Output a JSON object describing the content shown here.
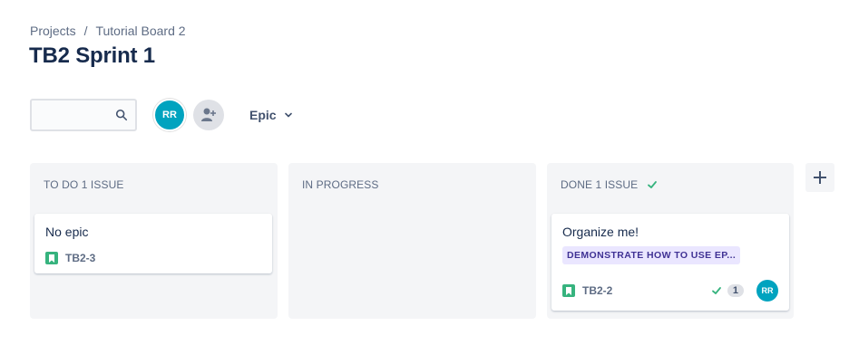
{
  "breadcrumb": {
    "project": "Projects",
    "separator": "/",
    "board": "Tutorial Board 2"
  },
  "title": "TB2 Sprint 1",
  "toolbar": {
    "search_value": "",
    "search_placeholder": "",
    "search_icon": "search-icon",
    "avatar_initials": "RR",
    "add_person_icon": "add-person-icon",
    "epic_filter_label": "Epic",
    "accent_color": "#00a3bf"
  },
  "columns": [
    {
      "header": "TO DO 1 ISSUE",
      "cards": [
        {
          "summary": "No epic",
          "key": "TB2-3"
        }
      ]
    },
    {
      "header": "IN PROGRESS",
      "cards": []
    },
    {
      "header": "DONE 1 ISSUE",
      "header_icon": "check-icon",
      "cards": [
        {
          "summary": "Organize me!",
          "epic": "DEMONSTRATE HOW TO USE EP...",
          "key": "TB2-2",
          "count": "1",
          "assignee": "RR"
        }
      ]
    }
  ],
  "add_column_icon": "plus-icon"
}
